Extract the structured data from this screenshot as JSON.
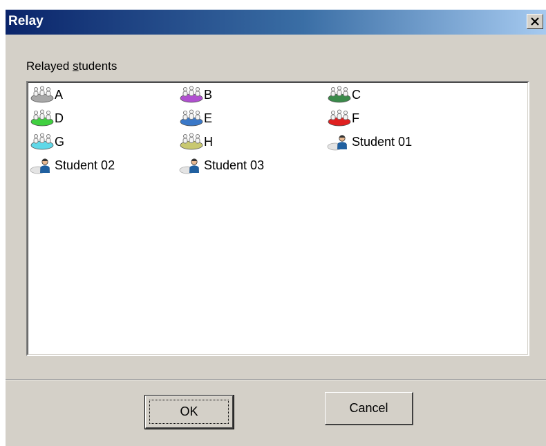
{
  "window": {
    "title": "Relay",
    "close_glyph": "×"
  },
  "group": {
    "label_pre": "Relayed ",
    "label_accel": "s",
    "label_post": "tudents"
  },
  "items": [
    {
      "label": "A",
      "icon": "group-icon",
      "color": "#a8a8a8"
    },
    {
      "label": "B",
      "icon": "group-icon",
      "color": "#b050d0"
    },
    {
      "label": "C",
      "icon": "group-icon",
      "color": "#3a8a4a"
    },
    {
      "label": "D",
      "icon": "group-icon",
      "color": "#40d040"
    },
    {
      "label": "E",
      "icon": "group-icon",
      "color": "#3a78c8"
    },
    {
      "label": "F",
      "icon": "group-icon",
      "color": "#e02020"
    },
    {
      "label": "G",
      "icon": "group-icon",
      "color": "#60d8e8"
    },
    {
      "label": "H",
      "icon": "group-icon",
      "color": "#c8c870"
    },
    {
      "label": "Student 01",
      "icon": "student-icon",
      "color": "#2060a0"
    },
    {
      "label": "Student 02",
      "icon": "student-icon",
      "color": "#2060a0"
    },
    {
      "label": "Student 03",
      "icon": "student-icon",
      "color": "#2060a0"
    }
  ],
  "buttons": {
    "ok": "OK",
    "cancel": "Cancel"
  }
}
